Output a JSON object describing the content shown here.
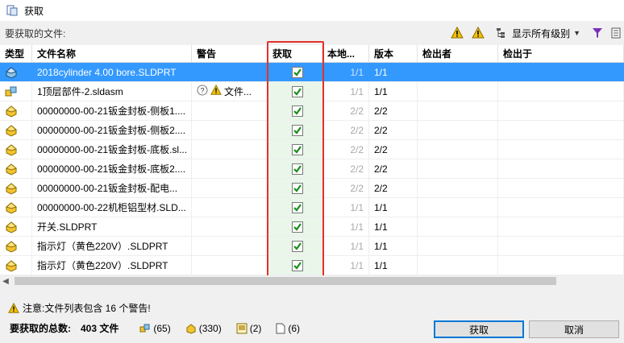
{
  "window": {
    "title": "获取"
  },
  "toolbar": {
    "caption": "要获取的文件:",
    "levels_label": "显示所有级别"
  },
  "columns": [
    "类型",
    "文件名称",
    "警告",
    "获取",
    "本地...",
    "版本",
    "检出者",
    "检出于"
  ],
  "rows": [
    {
      "type": "part",
      "name": "2018cylinder 4.00 bore.SLDPRT",
      "warning": "",
      "get": true,
      "local": "1/1",
      "version": "1/1",
      "checked_out_by": "",
      "checked_out_at": "",
      "selected": true
    },
    {
      "type": "assembly",
      "name": "1顶层部件-2.sldasm",
      "warning": "文件...",
      "get": true,
      "local": "1/1",
      "version": "1/1",
      "checked_out_by": "",
      "checked_out_at": "",
      "selected": false
    },
    {
      "type": "part",
      "name": "00000000-00-21钣金封板-侧板1....",
      "warning": "",
      "get": true,
      "local": "2/2",
      "version": "2/2",
      "checked_out_by": "",
      "checked_out_at": "",
      "selected": false
    },
    {
      "type": "part",
      "name": "00000000-00-21钣金封板-侧板2....",
      "warning": "",
      "get": true,
      "local": "2/2",
      "version": "2/2",
      "checked_out_by": "",
      "checked_out_at": "",
      "selected": false
    },
    {
      "type": "part",
      "name": "00000000-00-21钣金封板-底板.sl...",
      "warning": "",
      "get": true,
      "local": "2/2",
      "version": "2/2",
      "checked_out_by": "",
      "checked_out_at": "",
      "selected": false
    },
    {
      "type": "part",
      "name": "00000000-00-21钣金封板-底板2....",
      "warning": "",
      "get": true,
      "local": "2/2",
      "version": "2/2",
      "checked_out_by": "",
      "checked_out_at": "",
      "selected": false
    },
    {
      "type": "part",
      "name": "00000000-00-21钣金封板-配电...",
      "warning": "",
      "get": true,
      "local": "2/2",
      "version": "2/2",
      "checked_out_by": "",
      "checked_out_at": "",
      "selected": false
    },
    {
      "type": "part",
      "name": "00000000-00-22机柜铝型材.SLD...",
      "warning": "",
      "get": true,
      "local": "1/1",
      "version": "1/1",
      "checked_out_by": "",
      "checked_out_at": "",
      "selected": false
    },
    {
      "type": "part",
      "name": "开关.SLDPRT",
      "warning": "",
      "get": true,
      "local": "1/1",
      "version": "1/1",
      "checked_out_by": "",
      "checked_out_at": "",
      "selected": false
    },
    {
      "type": "part",
      "name": "指示灯（黄色220V）.SLDPRT",
      "warning": "",
      "get": true,
      "local": "1/1",
      "version": "1/1",
      "checked_out_by": "",
      "checked_out_at": "",
      "selected": false
    },
    {
      "type": "part",
      "name": "指示灯（黄色220V）.SLDPRT",
      "warning": "",
      "get": true,
      "local": "1/1",
      "version": "1/1",
      "checked_out_by": "",
      "checked_out_at": "",
      "selected": false
    }
  ],
  "footer": {
    "notice": "注意:文件列表包含 16 个警告!",
    "total_label": "要获取的总数:",
    "total_count": "403 文件",
    "stats": {
      "assemblies": "(65)",
      "parts": "(330)",
      "drawings": "(2)",
      "others": "(6)"
    },
    "ok_label": "获取",
    "cancel_label": "取消"
  },
  "colors": {
    "selection": "#3399ff",
    "highlight": "#e5302b",
    "check": "#1a8f1a",
    "warning": "#f2c200"
  }
}
